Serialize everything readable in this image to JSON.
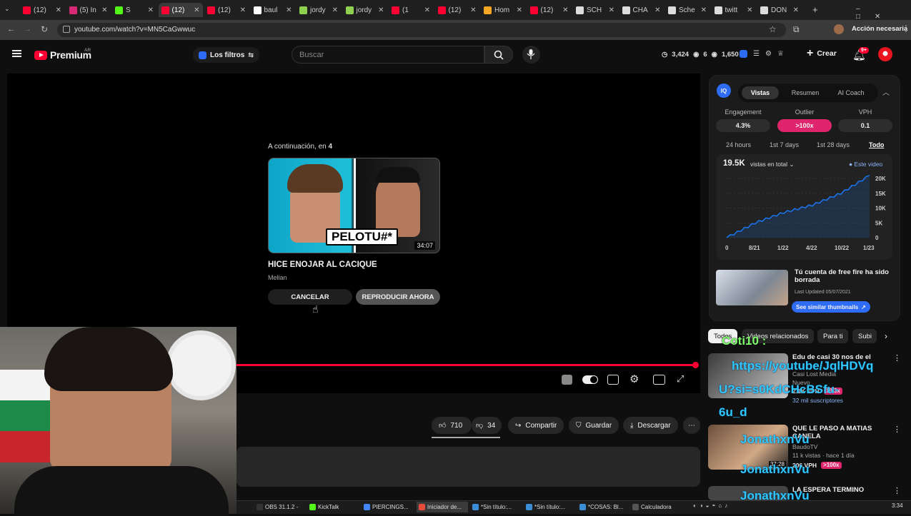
{
  "browser": {
    "tabs": [
      {
        "label": "(12)",
        "color": "#ff0033"
      },
      {
        "label": "(5) In",
        "color": "#d62976"
      },
      {
        "label": "S",
        "color": "#53fc18"
      },
      {
        "label": "(12)",
        "color": "#ff0033",
        "active": true
      },
      {
        "label": "(12)",
        "color": "#ff0033"
      },
      {
        "label": "baul",
        "color": "#ffffff"
      },
      {
        "label": "jordy",
        "color": "#8fd14f"
      },
      {
        "label": "jordy",
        "color": "#8fd14f"
      },
      {
        "label": "(1",
        "color": "#ff0033"
      },
      {
        "label": "(12)",
        "color": "#ff0033"
      },
      {
        "label": "Hom",
        "color": "#f5a623"
      },
      {
        "label": "(12)",
        "color": "#ff0033"
      },
      {
        "label": "SCH",
        "color": "#dddddd"
      },
      {
        "label": "CHA",
        "color": "#dddddd"
      },
      {
        "label": "Sche",
        "color": "#dddddd"
      },
      {
        "label": "twitt",
        "color": "#dddddd"
      },
      {
        "label": "DON",
        "color": "#dddddd"
      }
    ],
    "url": "youtube.com/watch?v=MN5CaGwwuc",
    "action_button": "Acción necesaria"
  },
  "header": {
    "logo_text": "Premium",
    "region": "AR",
    "filter_label": "Los filtros",
    "search_placeholder": "Buscar",
    "stats": {
      "views": "3,424",
      "watching": "6",
      "other": "1,650"
    },
    "create_label": "Crear",
    "notif_count": "9+"
  },
  "player": {
    "up_next_prefix": "A continuación, en",
    "countdown": "4",
    "thumb_text": "PELOTU#*",
    "duration": "34:07",
    "title": "HICE ENOJAR AL CACIQUE",
    "channel": "Melian",
    "cancel_label": "CANCELAR",
    "play_now_label": "REPRODUCIR AHORA",
    "progress_fraction": 0.99
  },
  "actions": {
    "likes": "710",
    "dislikes": "34",
    "share": "Compartir",
    "save": "Guardar",
    "download": "Descargar"
  },
  "vidiq": {
    "tabs": [
      "Vistas",
      "Resumen",
      "AI Coach"
    ],
    "stats": [
      {
        "label": "Engagement",
        "value": "4.3%"
      },
      {
        "label": "Outlier",
        "value": ">100x"
      },
      {
        "label": "VPH",
        "value": "0.1"
      }
    ],
    "ranges": [
      "24 hours",
      "1st 7 days",
      "1st 28 days",
      "Todo"
    ],
    "total": "19.5K",
    "total_label": "vistas en total",
    "legend": "Este video",
    "accent": "#1a73e8"
  },
  "chart_data": {
    "type": "line",
    "x": [
      "0",
      "8/21",
      "1/22",
      "4/22",
      "10/22",
      "1/23"
    ],
    "values": [
      0,
      5000,
      8500,
      11000,
      15000,
      21000
    ],
    "ytick_labels": [
      "0",
      "5K",
      "10K",
      "15K",
      "20K"
    ],
    "ylim": [
      0,
      20000
    ]
  },
  "promo": {
    "title": "Tú cuenta de free fire ha sido borrada",
    "updated": "Last Updated 05/07/2021",
    "button": "See similar thumbnails"
  },
  "chips": [
    "Todos",
    "Videos relacionados",
    "Para ti",
    "Subi"
  ],
  "recs": [
    {
      "title": "Edu de casi 30 nos de el",
      "channel": "Casi Lost Media",
      "badge": "Nuevo",
      "vph": "2.1K VPH",
      "mult": "19.3x",
      "subs": "32 mil suscriptores"
    },
    {
      "title": "QUE LE PASO A MATIAS CANELA",
      "channel": "BaudoTV",
      "meta": "11 k vistas · hace 1 día",
      "duration": "37:28",
      "vph": "206 VPH",
      "mult": ">100x"
    },
    {
      "title": "LA ESPERA TERMINO"
    }
  ],
  "chat_overlay": {
    "name1": "Coti10 :",
    "msg1": "https://youtube/JqlHDVq",
    "msg2": "U?si=s0KdCHcBSfu-",
    "msg3": "6u_d",
    "name2": "JonathxnVu",
    "name3": "JonathxnVu",
    "name4": "JonathxnVu"
  },
  "taskbar": [
    {
      "label": "OBS 31.1.2 -",
      "color": "#333333"
    },
    {
      "label": "KickTalk",
      "color": "#53fc18"
    },
    {
      "label": "PIERCINGS...",
      "color": "#4285f4"
    },
    {
      "label": "Iniciador de...",
      "color": "#e64b3b"
    },
    {
      "label": "*Sin título:...",
      "color": "#3b8ed6"
    },
    {
      "label": "*Sin título:...",
      "color": "#3b8ed6"
    },
    {
      "label": "*COSAS: Bl...",
      "color": "#3b8ed6"
    },
    {
      "label": "Calculadora",
      "color": "#555555"
    }
  ],
  "clock": "3:34"
}
